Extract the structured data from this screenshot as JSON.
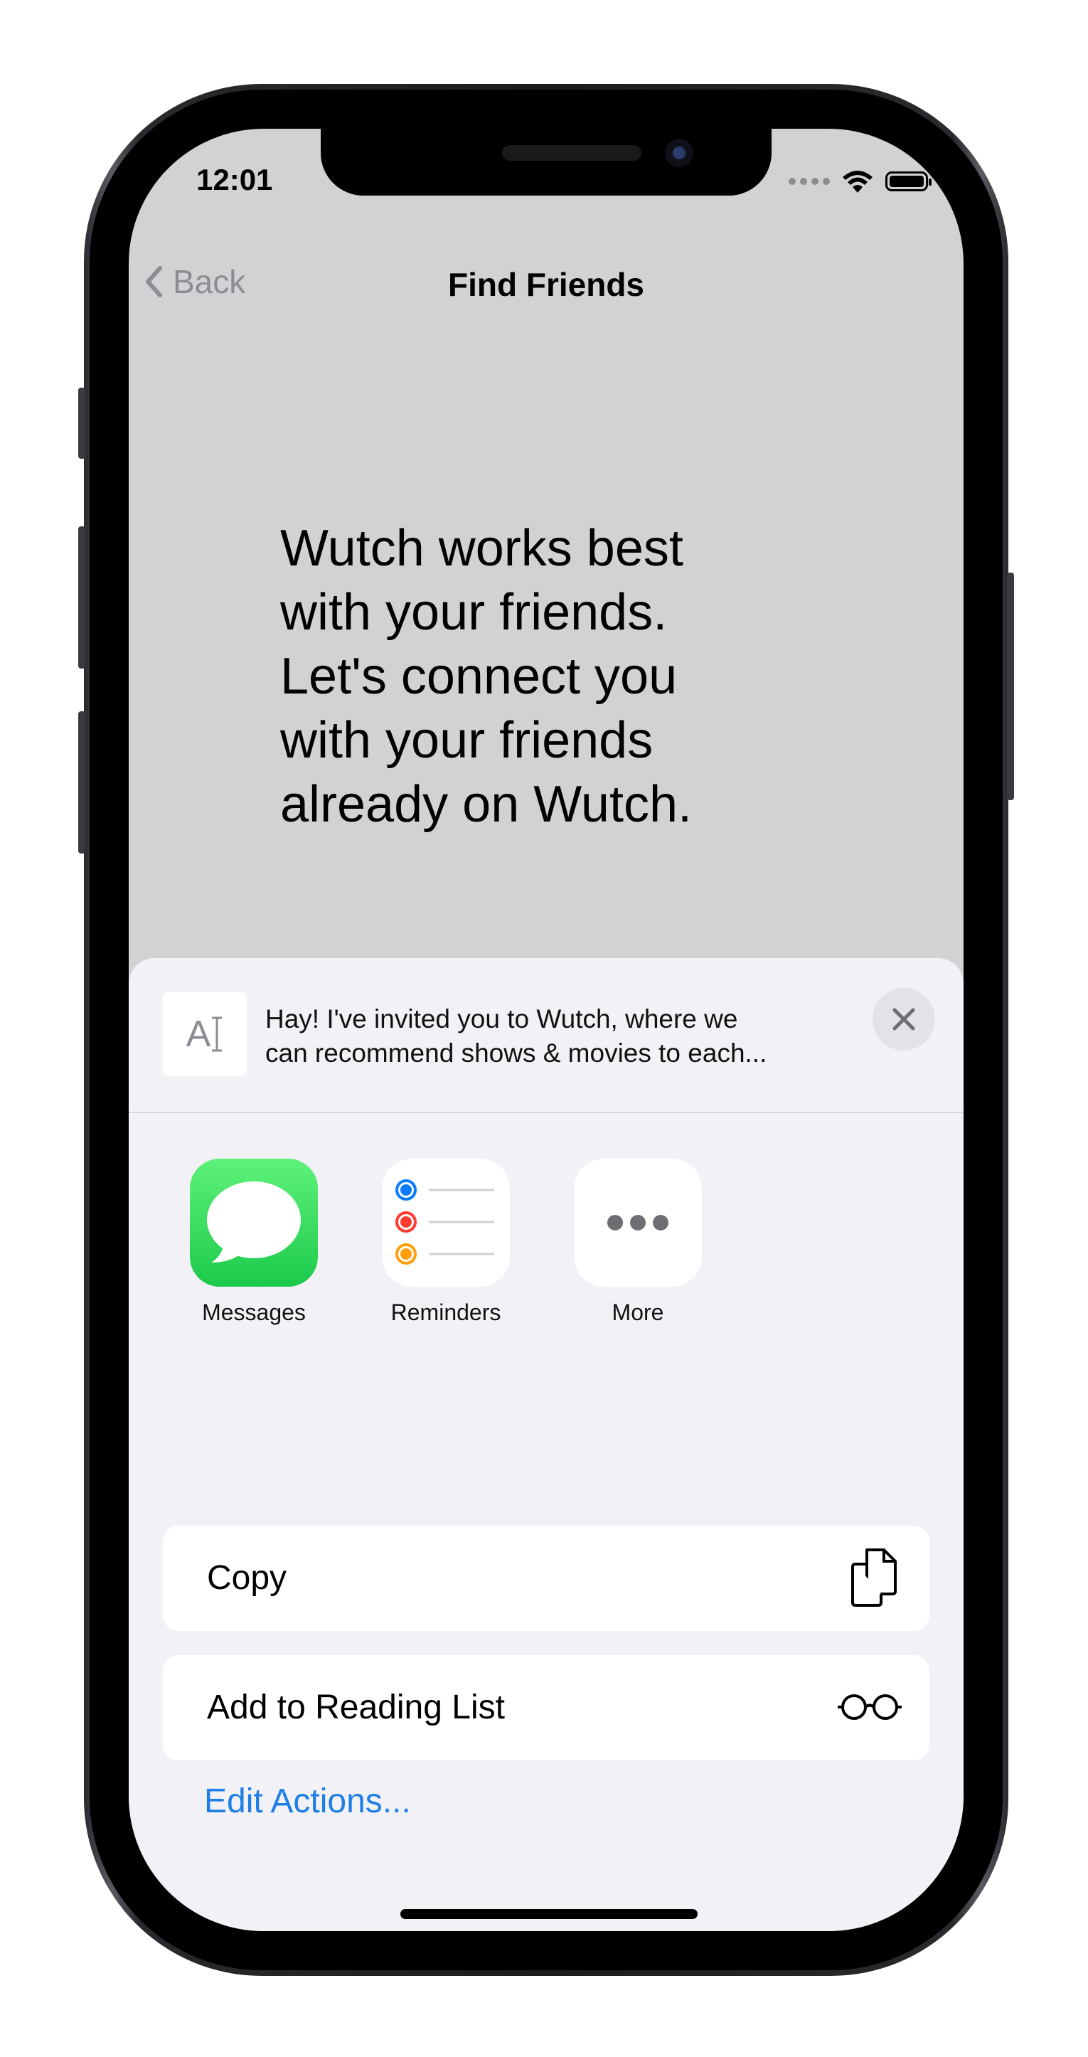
{
  "status_bar": {
    "time": "12:01"
  },
  "nav": {
    "back_label": "Back",
    "title": "Find Friends"
  },
  "hero_lines": [
    "Wutch works best",
    "with your friends.",
    "Let's connect you",
    "with your friends",
    "already on Wutch."
  ],
  "share_sheet": {
    "preview_line1": "Hay! I've invited you to Wutch, where we",
    "preview_line2": "can recommend shows & movies to each...",
    "preview_thumb_text": "A",
    "apps": [
      {
        "label": "Messages",
        "icon": "messages-icon",
        "color": "#2fd158"
      },
      {
        "label": "Reminders",
        "icon": "reminders-icon",
        "color": "#ffffff"
      },
      {
        "label": "More",
        "icon": "more-icon",
        "color": "#ffffff"
      }
    ],
    "actions": [
      {
        "label": "Copy",
        "icon": "copy-icon"
      },
      {
        "label": "Add to Reading List",
        "icon": "glasses-icon"
      }
    ],
    "edit_actions_label": "Edit Actions..."
  },
  "colors": {
    "accent": "#1f7fe5",
    "background_dim": "#d4d1d5",
    "sheet": "#f2f1f6"
  }
}
